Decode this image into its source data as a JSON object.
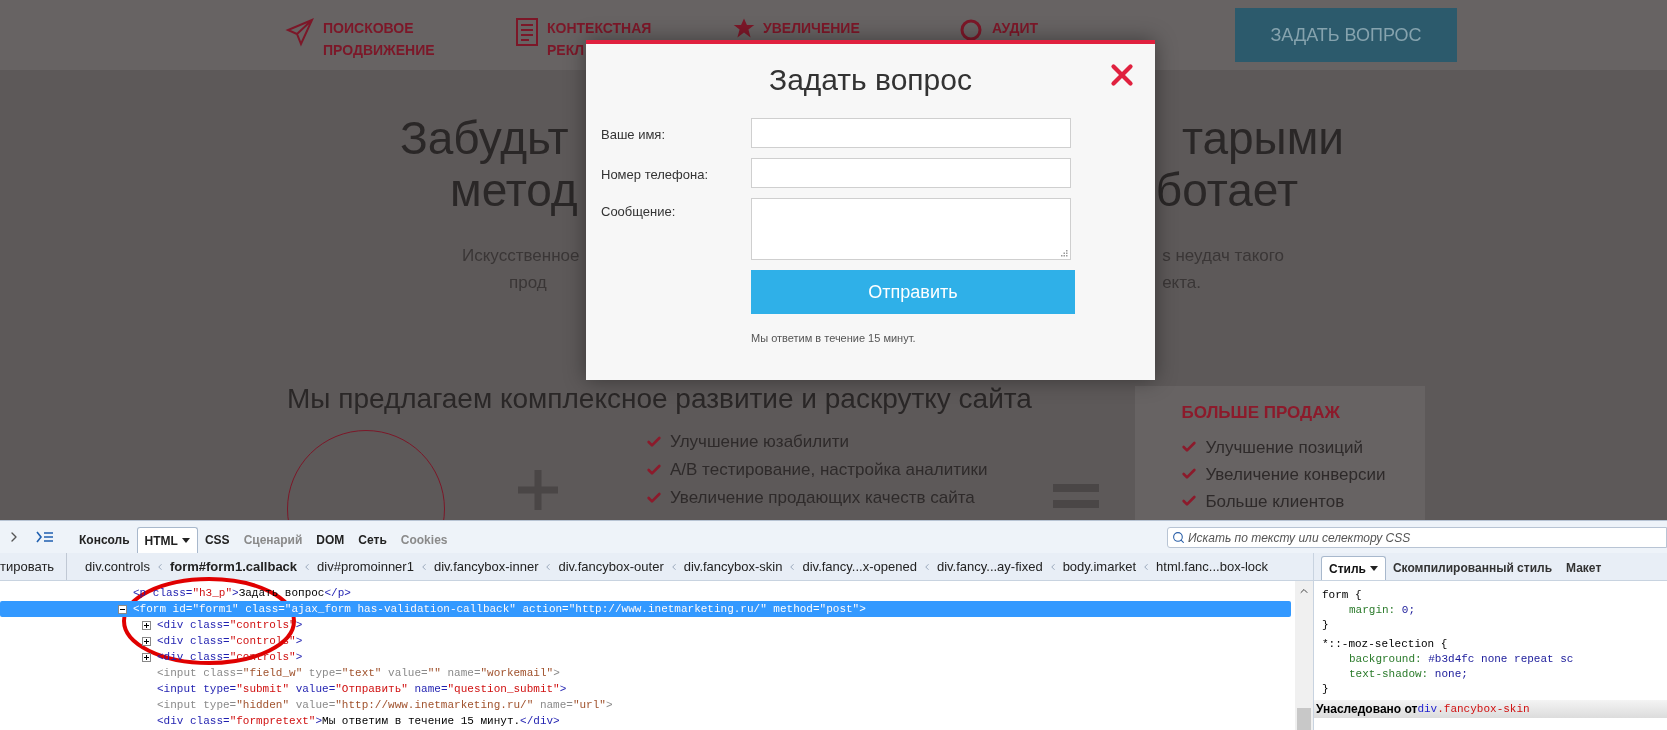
{
  "site": {
    "nav": [
      {
        "lines": [
          "ПОИСКОВОЕ",
          "ПРОДВИЖЕНИЕ"
        ]
      },
      {
        "lines": [
          "КОНТЕКСТНАЯ",
          "РЕКЛ"
        ]
      },
      {
        "lines": [
          "УВЕЛИЧЕНИЕ"
        ]
      },
      {
        "lines": [
          "АУДИТ"
        ]
      }
    ],
    "ask_button": "ЗАДАТЬ ВОПРОС",
    "headline": [
      [
        "Забудьт",
        "тарыми"
      ],
      [
        "метод",
        "ботает"
      ]
    ],
    "intro": [
      [
        "Искусственное",
        "s неудач такого"
      ],
      [
        "прод",
        "екта."
      ]
    ],
    "section_title": "Мы предлагаем комплексное развитие и раскрутку сайта",
    "checklist": [
      "Улучшение юзабилити",
      "A/B тестирование, настройка аналитики",
      "Увеличение продающих качеств сайта"
    ],
    "result_box": {
      "title": "БОЛЬШЕ ПРОДАЖ",
      "items": [
        "Улучшение позиций",
        "Увеличение конверсии",
        "Больше клиентов"
      ]
    }
  },
  "modal": {
    "title": "Задать вопрос",
    "fields": [
      {
        "label": "Ваше имя:",
        "kind": "input"
      },
      {
        "label": "Номер телефона:",
        "kind": "input"
      },
      {
        "label": "Сообщение:",
        "kind": "textarea"
      }
    ],
    "submit": "Отправить",
    "note": "Мы ответим в течение 15 минут."
  },
  "devtools": {
    "tabs": [
      {
        "label": "Консоль",
        "selected": false,
        "disabled": false
      },
      {
        "label": "HTML",
        "selected": true,
        "disabled": false
      },
      {
        "label": "CSS",
        "selected": false,
        "disabled": false
      },
      {
        "label": "Сценарий",
        "selected": false,
        "disabled": true
      },
      {
        "label": "DOM",
        "selected": false,
        "disabled": false
      },
      {
        "label": "Сеть",
        "selected": false,
        "disabled": false
      },
      {
        "label": "Cookies",
        "selected": false,
        "disabled": true
      }
    ],
    "search": {
      "placeholder": "Искать по тексту или селектору CSS"
    },
    "edit_button": "тировать",
    "breadcrumbs": [
      {
        "label": "div.controls",
        "selected": false
      },
      {
        "label": "form#form1.callback",
        "selected": true
      },
      {
        "label": "div#promoinner1",
        "selected": false
      },
      {
        "label": "div.fancybox-inner",
        "selected": false
      },
      {
        "label": "div.fancybox-outer",
        "selected": false
      },
      {
        "label": "div.fancybox-skin",
        "selected": false
      },
      {
        "label": "div.fancy...x-opened",
        "selected": false
      },
      {
        "label": "div.fancy...ay-fixed",
        "selected": false
      },
      {
        "label": "body.imarket",
        "selected": false
      },
      {
        "label": "html.fanc...box-lock",
        "selected": false
      }
    ],
    "html_lines": [
      {
        "expandable": false,
        "selected": false,
        "dimmed": false,
        "tokens": [
          {
            "kind": "tag",
            "text": "<p class="
          },
          {
            "kind": "value",
            "text": "\"h3_p\""
          },
          {
            "kind": "tag",
            "text": ">"
          },
          {
            "kind": "text",
            "text": "Задать вопрос"
          },
          {
            "kind": "tag",
            "text": "</p>"
          }
        ]
      },
      {
        "expandable": true,
        "expanded": true,
        "selected": true,
        "dimmed": false,
        "tokens": [
          {
            "kind": "tag",
            "text": "<form id="
          },
          {
            "kind": "value",
            "text": "\"form1\""
          },
          {
            "kind": "tag",
            "text": " class="
          },
          {
            "kind": "value",
            "text": "\"ajax_form has-validation-callback\""
          },
          {
            "kind": "tag",
            "text": " action="
          },
          {
            "kind": "value",
            "text": "\"http://www.inetmarketing.ru/\""
          },
          {
            "kind": "tag",
            "text": " method="
          },
          {
            "kind": "value",
            "text": "\"post\""
          },
          {
            "kind": "tag",
            "text": ">"
          }
        ],
        "children": [
          {
            "expandable": true,
            "expanded": false,
            "selected": false,
            "dimmed": false,
            "tokens": [
              {
                "kind": "tag",
                "text": "<div class="
              },
              {
                "kind": "value",
                "text": "\"controls\""
              },
              {
                "kind": "tag",
                "text": ">"
              }
            ]
          },
          {
            "expandable": true,
            "expanded": false,
            "selected": false,
            "dimmed": false,
            "tokens": [
              {
                "kind": "tag",
                "text": "<div class="
              },
              {
                "kind": "value",
                "text": "\"controls\""
              },
              {
                "kind": "tag",
                "text": ">"
              }
            ]
          },
          {
            "expandable": true,
            "expanded": false,
            "selected": false,
            "dimmed": false,
            "tokens": [
              {
                "kind": "tag",
                "text": "<div class="
              },
              {
                "kind": "value",
                "text": "\"controls\""
              },
              {
                "kind": "tag",
                "text": ">"
              }
            ]
          },
          {
            "expandable": false,
            "selected": false,
            "dimmed": true,
            "tokens": [
              {
                "kind": "tag",
                "text": "<input class="
              },
              {
                "kind": "value",
                "text": "\"field_w\""
              },
              {
                "kind": "tag",
                "text": " type="
              },
              {
                "kind": "value",
                "text": "\"text\""
              },
              {
                "kind": "tag",
                "text": " value="
              },
              {
                "kind": "value",
                "text": "\"\""
              },
              {
                "kind": "tag",
                "text": " name="
              },
              {
                "kind": "value",
                "text": "\"workemail\""
              },
              {
                "kind": "tag",
                "text": ">"
              }
            ]
          },
          {
            "expandable": false,
            "selected": false,
            "dimmed": false,
            "tokens": [
              {
                "kind": "tag",
                "text": "<input type="
              },
              {
                "kind": "value",
                "text": "\"submit\""
              },
              {
                "kind": "tag",
                "text": " value="
              },
              {
                "kind": "value",
                "text": "\"Отправить\""
              },
              {
                "kind": "tag",
                "text": " name="
              },
              {
                "kind": "value",
                "text": "\"question_submit\""
              },
              {
                "kind": "tag",
                "text": ">"
              }
            ]
          },
          {
            "expandable": false,
            "selected": false,
            "dimmed": true,
            "tokens": [
              {
                "kind": "tag",
                "text": "<input type="
              },
              {
                "kind": "value",
                "text": "\"hidden\""
              },
              {
                "kind": "tag",
                "text": " value="
              },
              {
                "kind": "value",
                "text": "\"http://www.inetmarketing.ru/\""
              },
              {
                "kind": "tag",
                "text": " name="
              },
              {
                "kind": "value",
                "text": "\"url\""
              },
              {
                "kind": "tag",
                "text": ">"
              }
            ]
          },
          {
            "expandable": false,
            "selected": false,
            "dimmed": false,
            "tokens": [
              {
                "kind": "tag",
                "text": "<div class="
              },
              {
                "kind": "value",
                "text": "\"formpretext\""
              },
              {
                "kind": "tag",
                "text": ">"
              },
              {
                "kind": "text",
                "text": "Мы ответим в течение 15 минут."
              },
              {
                "kind": "tag",
                "text": "</div>"
              }
            ]
          }
        ]
      }
    ],
    "style_tabs": [
      {
        "label": "Стиль",
        "selected": true
      },
      {
        "label": "Скомпилированный стиль",
        "selected": false
      },
      {
        "label": "Макет",
        "selected": false
      }
    ],
    "style_lines": [
      {
        "kind": "rule_open",
        "text": "form {"
      },
      {
        "kind": "declaration",
        "property": "margin:",
        "value": "0;"
      },
      {
        "kind": "rule_close",
        "text": "}"
      },
      {
        "kind": "rule_open",
        "text": "*::-moz-selection {"
      },
      {
        "kind": "declaration",
        "property": "background:",
        "value": "#b3d4fc none repeat sc"
      },
      {
        "kind": "declaration",
        "property": "text-shadow:",
        "value": "none;"
      },
      {
        "kind": "rule_close",
        "text": "}"
      },
      {
        "kind": "inherited",
        "label": "Унаследовано от",
        "element": "div",
        "selector": ".fancybox-skin"
      }
    ]
  }
}
